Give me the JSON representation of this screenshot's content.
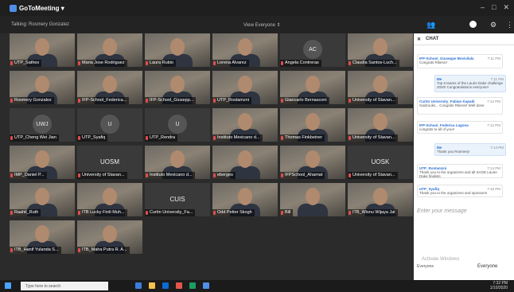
{
  "window": {
    "app_title": "GoToMeeting ▾",
    "controls": [
      "–",
      "□",
      "✕"
    ]
  },
  "toolbar": {
    "speaking": "Talking: Rosmery Gonzalez",
    "view": "View Everyone ⇕"
  },
  "top_icons": [
    "people-icon",
    "camera-icon",
    "gear-icon",
    "more-icon"
  ],
  "participants": [
    {
      "name": "UTP_Sathes",
      "kind": "video"
    },
    {
      "name": "Maria Jose Rodriguez",
      "kind": "video"
    },
    {
      "name": "Laura Rubio",
      "kind": "video"
    },
    {
      "name": "Lorena Alvarez",
      "kind": "video"
    },
    {
      "name": "Angela Contreras",
      "kind": "initials",
      "initials": "AC"
    },
    {
      "name": "Claudia Santos-Luch...",
      "kind": "video"
    },
    {
      "name": "Rosmery Gonzalez",
      "kind": "video"
    },
    {
      "name": "IFP-School_Federica...",
      "kind": "video"
    },
    {
      "name": "IFP-School_Giusepp...",
      "kind": "video"
    },
    {
      "name": "UTP_Rostamzni",
      "kind": "video"
    },
    {
      "name": "Giancarlo Bernasconi",
      "kind": "video"
    },
    {
      "name": "University of Stavan...",
      "kind": "video"
    },
    {
      "name": "UTP_Cheng Wei Jian",
      "kind": "initials",
      "initials": "UWJ"
    },
    {
      "name": "UTP_Syafiq",
      "kind": "initials",
      "initials": "U"
    },
    {
      "name": "UTP_Rendra",
      "kind": "initials",
      "initials": "U"
    },
    {
      "name": "Instituto Mexicano d...",
      "kind": "video"
    },
    {
      "name": "Thomas Finkbeiner",
      "kind": "video"
    },
    {
      "name": "University of Stavan...",
      "kind": "video"
    },
    {
      "name": "IMP_Daniel P...",
      "kind": "video"
    },
    {
      "name": "University of Stavan...",
      "kind": "plain",
      "initials": "UOSM"
    },
    {
      "name": "Instituto Mexicano d...",
      "kind": "video"
    },
    {
      "name": "eberges",
      "kind": "video"
    },
    {
      "name": "IFPSchool_Ahamat",
      "kind": "video"
    },
    {
      "name": "University of Stavan...",
      "kind": "plain",
      "initials": "UOSK"
    },
    {
      "name": "Raahil_Ruth",
      "kind": "video"
    },
    {
      "name": "ITB Lucky Firdi Muh...",
      "kind": "video"
    },
    {
      "name": "Curtin University_Fa...",
      "kind": "plain",
      "initials": "CUIS"
    },
    {
      "name": "Odd Petter Skogh",
      "kind": "video"
    },
    {
      "name": "Bill",
      "kind": "video"
    },
    {
      "name": "ITB_Wisnu Wijaya Jal",
      "kind": "video"
    },
    {
      "name": "ITB_Hanif Yulanda S...",
      "kind": "video"
    },
    {
      "name": "ITB_Maha Putra R. A...",
      "kind": "video"
    }
  ],
  "chat": {
    "title": "CHAT",
    "messages": [
      {
        "from": "IFP-School_Giuseppe Bevivilala",
        "time": "7:11 PM",
        "text": "Congrats Rikera!!"
      },
      {
        "from": "Me",
        "time": "7:11 PM",
        "text": "Top 6 teams of the Laurie Dake challenge 2020! Congratulations everyone!",
        "mine": true
      },
      {
        "from": "Curtin University_Fabian Kapadi",
        "time": "7:12 PM",
        "text": "Gadzooks... Congrats Rikera!! Well done"
      },
      {
        "from": "IFP-School_Federica Lagona",
        "time": "7:12 PM",
        "text": "congrats to all of you!!"
      },
      {
        "from": "Me",
        "time": "7:14 PM",
        "text": "Thank you Rosmery!",
        "mine": true
      },
      {
        "from": "UTP_Rostamzni",
        "time": "7:14 PM",
        "text": "Thank you to the organizers and all SAGE Laurie Dake finalists"
      },
      {
        "from": "UTP_Syafiq",
        "time": "7:15 PM",
        "text": "Thank you to the organizers and sponsors!"
      }
    ],
    "input_placeholder": "Enter your message",
    "to_label": "Everyone",
    "send_to": "Everyone"
  },
  "watermark": "Activate Windows",
  "taskbar": {
    "search_placeholder": "Type here to search",
    "time": "7:32 PM",
    "date": "1/10/2020"
  },
  "colors": {
    "accent": "#2d6fd1",
    "muted": "#e24d4d"
  }
}
